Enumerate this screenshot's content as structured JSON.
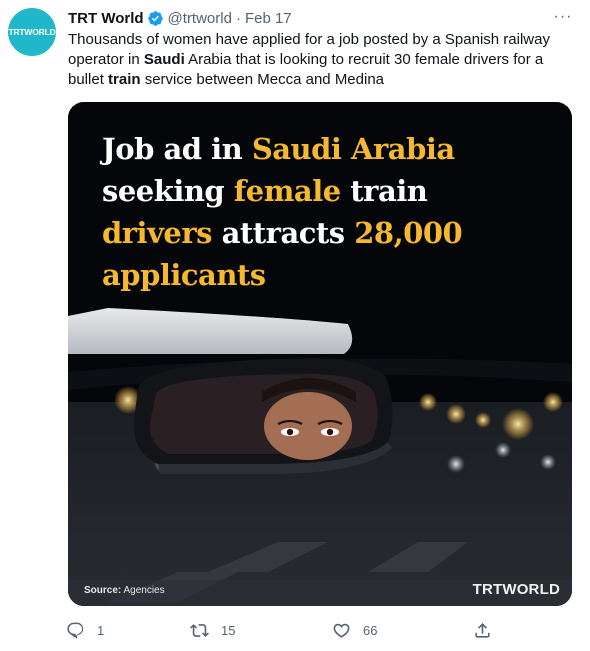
{
  "tweet": {
    "avatar_text": "TRTWORLD",
    "author_name": "TRT World",
    "handle": "@trtworld",
    "separator": "·",
    "date": "Feb 17",
    "more_label": "···",
    "text": {
      "p1": "Thousands of women have applied for a job posted by a Spanish railway operator in ",
      "b1": "Saudi",
      "p2": " Arabia that is looking to recruit 30 female drivers for a bullet ",
      "b2": "train",
      "p3": " service between Mecca and Medina"
    }
  },
  "media": {
    "headline": {
      "w1": "Job ad in ",
      "h1": "Saudi Arabia",
      "w2": "seeking ",
      "h2": "female",
      "w3": " train",
      "h3": "drivers",
      "w4": " attracts ",
      "h4": "28,000",
      "h5": "applicants"
    },
    "source_label": "Source:",
    "source_value": " Agencies",
    "watermark": "TRTWORLD"
  },
  "actions": {
    "replies": "1",
    "retweets": "15",
    "likes": "66"
  },
  "colors": {
    "accent_yellow": "#f5b82e",
    "avatar_bg": "#1fb7c9",
    "verified_blue": "#1d9bf0",
    "muted_text": "#536471"
  }
}
